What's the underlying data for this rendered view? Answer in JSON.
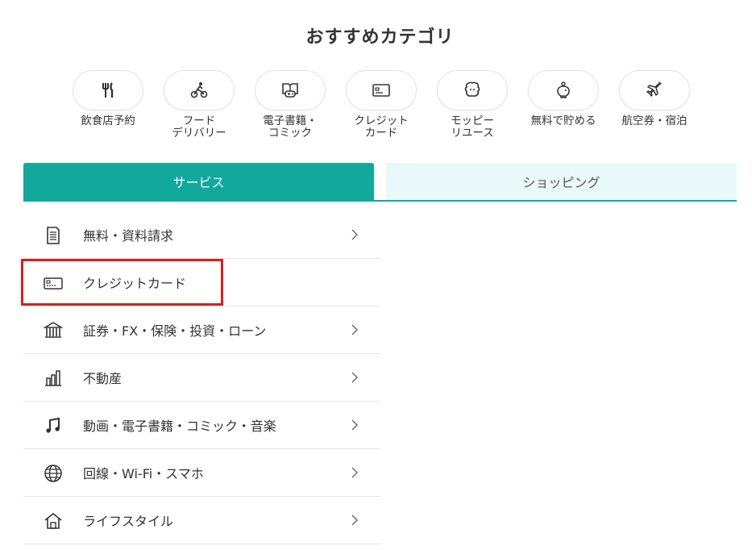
{
  "title": "おすすめカテゴリ",
  "categories": [
    {
      "label": "飲食店予約",
      "icon": "fork-knife-icon"
    },
    {
      "label": "フード\nデリバリー",
      "icon": "bicycle-delivery-icon"
    },
    {
      "label": "電子書籍・\nコミック",
      "icon": "book-game-icon"
    },
    {
      "label": "クレジット\nカード",
      "icon": "credit-card-icon"
    },
    {
      "label": "モッピー\nリユース",
      "icon": "reuse-character-icon"
    },
    {
      "label": "無料で貯める",
      "icon": "piggy-bank-icon"
    },
    {
      "label": "航空券・宿泊",
      "icon": "airplane-icon"
    }
  ],
  "tabs": {
    "service": "サービス",
    "shopping": "ショッピング"
  },
  "service_list": [
    {
      "label": "無料・資料請求",
      "icon": "document-icon",
      "chevron": true
    },
    {
      "label": "クレジットカード",
      "icon": "credit-card-icon",
      "chevron": false
    },
    {
      "label": "証券・FX・保険・投資・ローン",
      "icon": "bank-icon",
      "chevron": true
    },
    {
      "label": "不動産",
      "icon": "building-icon",
      "chevron": true
    },
    {
      "label": "動画・電子書籍・コミック・音楽",
      "icon": "music-note-icon",
      "chevron": true
    },
    {
      "label": "回線・Wi-Fi・スマホ",
      "icon": "globe-icon",
      "chevron": true
    },
    {
      "label": "ライフスタイル",
      "icon": "house-icon",
      "chevron": true
    }
  ],
  "colors": {
    "accent": "#12a99c",
    "tab_inactive_bg": "#e9f8f9",
    "highlight": "#e01b1b"
  }
}
